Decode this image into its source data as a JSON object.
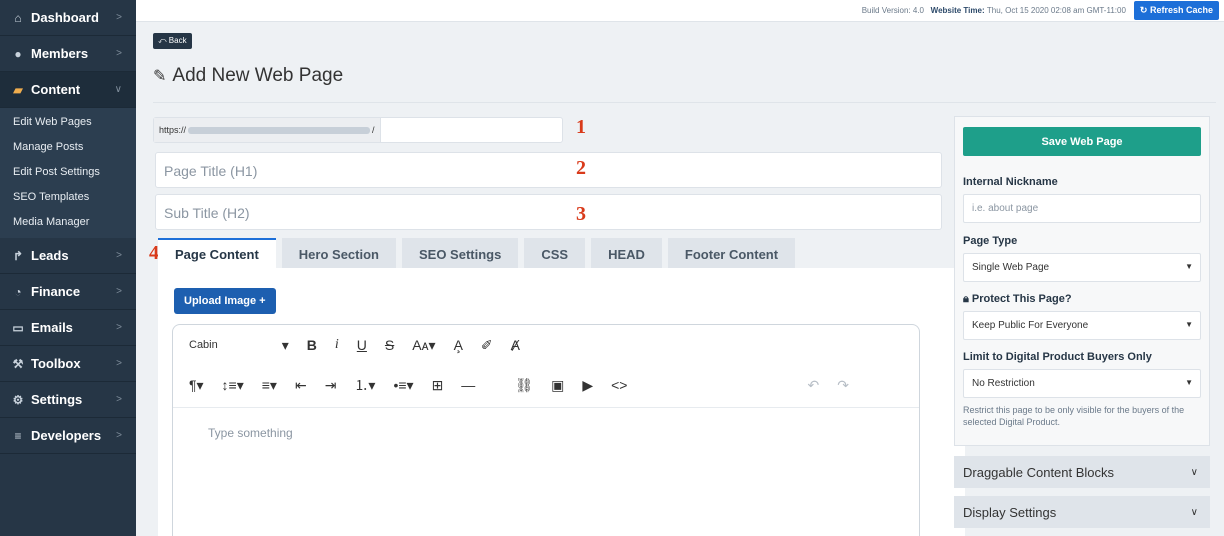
{
  "sidebar": {
    "items": [
      {
        "label": "Dashboard",
        "icon": "home-icon"
      },
      {
        "label": "Members",
        "icon": "users-icon"
      },
      {
        "label": "Content",
        "icon": "folder-open-icon"
      },
      {
        "label": "Leads",
        "icon": "share-icon"
      },
      {
        "label": "Finance",
        "icon": "pie-chart-icon"
      },
      {
        "label": "Emails",
        "icon": "inbox-icon"
      },
      {
        "label": "Toolbox",
        "icon": "wrench-icon"
      },
      {
        "label": "Settings",
        "icon": "gear-icon"
      },
      {
        "label": "Developers",
        "icon": "sliders-icon"
      }
    ],
    "content_subitems": [
      "Edit Web Pages",
      "Manage Posts",
      "Edit Post Settings",
      "SEO Templates",
      "Media Manager"
    ]
  },
  "topbar": {
    "build_label": "Build Version:",
    "build_value": "4.0",
    "time_label": "Website Time:",
    "time_value": "Thu, Oct 15 2020 02:08 am GMT-11:00",
    "refresh_label": "Refresh Cache"
  },
  "page": {
    "back_label": "Back",
    "title": "Add New Web Page",
    "url_prefix": "https://",
    "url_suffix": "/",
    "page_title_placeholder": "Page Title (H1)",
    "sub_title_placeholder": "Sub Title (H2)"
  },
  "markers": [
    "1",
    "2",
    "3",
    "4"
  ],
  "tabs": [
    "Page Content",
    "Hero Section",
    "SEO Settings",
    "CSS",
    "HEAD",
    "Footer Content"
  ],
  "editor": {
    "upload_label": "Upload Image +",
    "font_name": "Cabin",
    "placeholder": "Type something"
  },
  "right_panel": {
    "save_label": "Save Web Page",
    "nickname_label": "Internal Nickname",
    "nickname_placeholder": "i.e. about page",
    "page_type_label": "Page Type",
    "page_type_value": "Single Web Page",
    "protect_label": "Protect This Page?",
    "protect_value": "Keep Public For Everyone",
    "limit_label": "Limit to Digital Product Buyers Only",
    "limit_value": "No Restriction",
    "help_text": "Restrict this page to be only visible for the buyers of the selected Digital Product."
  },
  "accordions": [
    "Draggable Content Blocks",
    "Display Settings"
  ]
}
